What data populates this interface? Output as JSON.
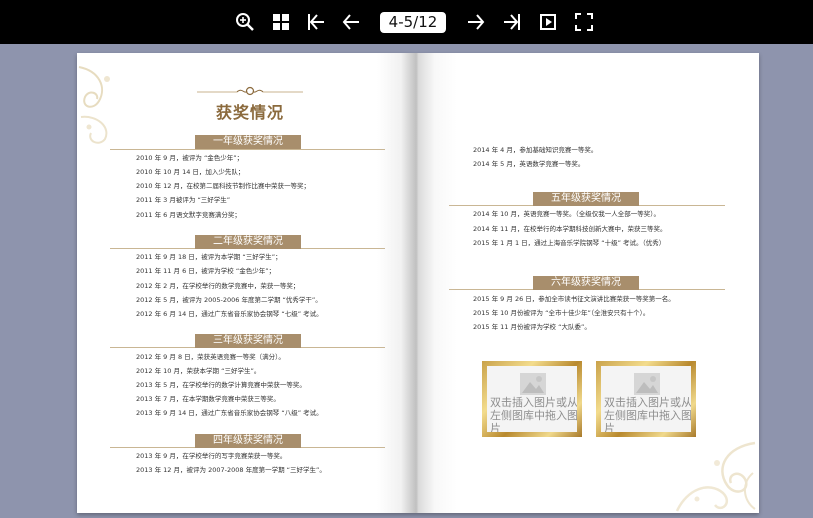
{
  "toolbar": {
    "page_indicator": "4-5/12",
    "buttons": [
      "zoom-in-icon",
      "thumbnails-icon",
      "first-page-icon",
      "prev-page-icon",
      "next-page-icon",
      "last-page-icon",
      "autoplay-icon",
      "fullscreen-icon"
    ]
  },
  "left_page": {
    "title": "获奖情况",
    "sections": [
      {
        "heading": "一年级获奖情况",
        "lines": [
          "2010 年 9 月，被评为 “金色少年”；",
          "2010 年 10 月 14 日，加入少先队；",
          "2010 年 12 月，在校第二届科技节制作比赛中荣获一等奖；",
          "2011 年 3 月被评为 “三好学生”",
          "2011 年 6 月语文默字竞赛满分奖；"
        ]
      },
      {
        "heading": "二年级获奖情况",
        "lines": [
          "2011 年 9 月 18 日，被评为本学期 “三好学生”；",
          "2011 年 11 月 6 日，被评为学校 “金色少年”；",
          "2012 年 2 月，在学校举行的数学竞赛中，荣获一等奖；",
          "2012 年 5 月，被评为 2005-2006 年度第二学期 “优秀学干”。",
          "2012 年 6 月 14 日，通过广东省音乐家协会钢琴 “七级” 考试。"
        ]
      },
      {
        "heading": "三年级获奖情况",
        "lines": [
          "2012 年 9 月 8 日，荣获英语竞赛一等奖（满分）。",
          "2012 年 10 月，荣获本学期 “三好学生”。",
          "2013 年 5 月，在学校举行的数学计算竞赛中荣获一等奖。",
          "2013 年 7 月，在本学期数学竞赛中荣获三等奖。",
          "2013 年 9 月 14 日，通过广东省音乐家协会钢琴 “八级” 考试。"
        ]
      },
      {
        "heading": "四年级获奖情况",
        "lines": [
          "2013 年 9 月，在学校举行的写字竞赛荣获一等奖。",
          "2013 年 12 月，被评为 2007-2008 年度第一学期 “三好学生”。"
        ]
      }
    ]
  },
  "right_page": {
    "top_lines": [
      "2014 年 4 月，参加基础知识竞赛一等奖。",
      "2014 年 5 月，英语数学竞赛一等奖。"
    ],
    "sections": [
      {
        "heading": "五年级获奖情况",
        "lines": [
          "2014 年 10 月，英语竞赛一等奖。（全级仅我一人全部一等奖）。",
          "2014 年 11 月，在校举行的本学期科技创新大赛中，荣获三等奖。",
          "2015 年 1 月 1 日，通过上海音乐学院钢琴 “十级” 考试。（优秀）"
        ]
      },
      {
        "heading": "六年级获奖情况",
        "lines": [
          "2015 年 9 月 26 日，参加全市读书征文演讲比赛荣获一等奖第一名。",
          "2015 年 10 月份被评为 “全市十佳少年”（全淮安只有十个）。",
          "2015 年 11 月份被评为学校 “大队委”。"
        ]
      }
    ],
    "placeholders": [
      "双击插入图片或从左侧图库中拖入图片",
      "双击插入图片或从左侧图库中拖入图片"
    ]
  },
  "colors": {
    "accent": "#a88e6c",
    "title": "#8b6a3d",
    "background": "#8e94ad"
  }
}
